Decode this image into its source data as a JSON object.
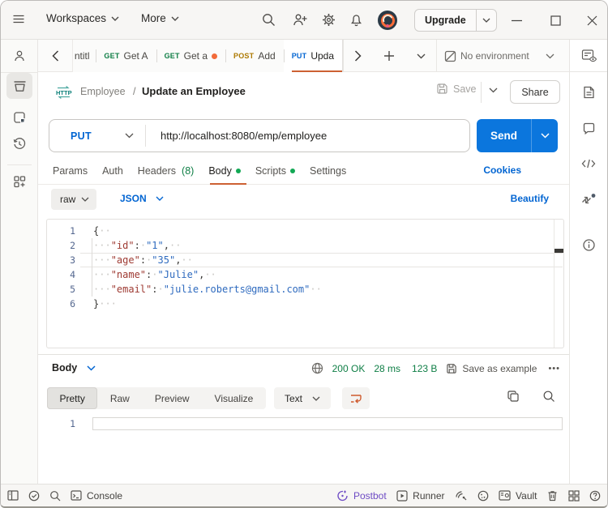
{
  "topbar": {
    "workspaces_label": "Workspaces",
    "more_label": "More",
    "upgrade_label": "Upgrade"
  },
  "tabbar": {
    "tabs": [
      {
        "method": "",
        "title": "ntitl"
      },
      {
        "method": "GET",
        "title": "Get A"
      },
      {
        "method": "GET",
        "title": "Get a"
      },
      {
        "method": "POST",
        "title": "Add"
      },
      {
        "method": "PUT",
        "title": "Upda"
      }
    ],
    "environment": "No environment"
  },
  "request": {
    "collection": "Employee",
    "separator": "/",
    "name": "Update an Employee",
    "save_label": "Save",
    "share_label": "Share",
    "method": "PUT",
    "url": "http://localhost:8080/emp/employee",
    "send_label": "Send",
    "tabs": [
      "Params",
      "Auth",
      "Headers",
      "Body",
      "Scripts",
      "Settings"
    ],
    "headers_count": "(8)",
    "cookies_label": "Cookies",
    "body_mode": "raw",
    "body_language": "JSON",
    "beautify_label": "Beautify"
  },
  "editor": {
    "lines": [
      {
        "num": "1",
        "tokens": [
          {
            "t": "p",
            "v": "{"
          },
          {
            "t": "ws",
            "v": "··"
          }
        ]
      },
      {
        "num": "2",
        "tokens": [
          {
            "t": "ws",
            "v": "···"
          },
          {
            "t": "key",
            "v": "\"id\""
          },
          {
            "t": "p",
            "v": ":"
          },
          {
            "t": "ws",
            "v": "·"
          },
          {
            "t": "val",
            "v": "\"1\""
          },
          {
            "t": "p",
            "v": ","
          },
          {
            "t": "ws",
            "v": "··"
          }
        ]
      },
      {
        "num": "3",
        "tokens": [
          {
            "t": "ws",
            "v": "···"
          },
          {
            "t": "key",
            "v": "\"age\""
          },
          {
            "t": "p",
            "v": ":"
          },
          {
            "t": "ws",
            "v": "·"
          },
          {
            "t": "val",
            "v": "\"35\""
          },
          {
            "t": "p",
            "v": ","
          },
          {
            "t": "ws",
            "v": "··"
          }
        ]
      },
      {
        "num": "4",
        "tokens": [
          {
            "t": "ws",
            "v": "···"
          },
          {
            "t": "key",
            "v": "\"name\""
          },
          {
            "t": "p",
            "v": ":"
          },
          {
            "t": "ws",
            "v": "·"
          },
          {
            "t": "val",
            "v": "\"Julie\""
          },
          {
            "t": "p",
            "v": ","
          },
          {
            "t": "ws",
            "v": "··"
          }
        ]
      },
      {
        "num": "5",
        "tokens": [
          {
            "t": "ws",
            "v": "···"
          },
          {
            "t": "key",
            "v": "\"email\""
          },
          {
            "t": "p",
            "v": ":"
          },
          {
            "t": "ws",
            "v": "·"
          },
          {
            "t": "val",
            "v": "\"julie.roberts@gmail.com\""
          },
          {
            "t": "ws",
            "v": "··"
          }
        ]
      },
      {
        "num": "6",
        "tokens": [
          {
            "t": "p",
            "v": "}"
          },
          {
            "t": "ws",
            "v": "···"
          }
        ]
      }
    ]
  },
  "response": {
    "body_label": "Body",
    "status": "200 OK",
    "time": "28 ms",
    "size": "123 B",
    "save_example_label": "Save as example",
    "views": [
      "Pretty",
      "Raw",
      "Preview",
      "Visualize"
    ],
    "format": "Text",
    "line_number": "1"
  },
  "statusbar": {
    "console_label": "Console",
    "postbot_label": "Postbot",
    "runner_label": "Runner",
    "vault_label": "Vault"
  },
  "colors": {
    "accent_orange": "#cd6133",
    "unsaved_dot": "#f26b3a",
    "link_blue": "#0265d2",
    "send_blue": "#0b76dd",
    "get_green": "#0e7e45",
    "post_yellow": "#ad7a03",
    "put_blue": "#0265d2",
    "status_green": "#0e7e45",
    "postbot_purple": "#6e4bc4"
  }
}
